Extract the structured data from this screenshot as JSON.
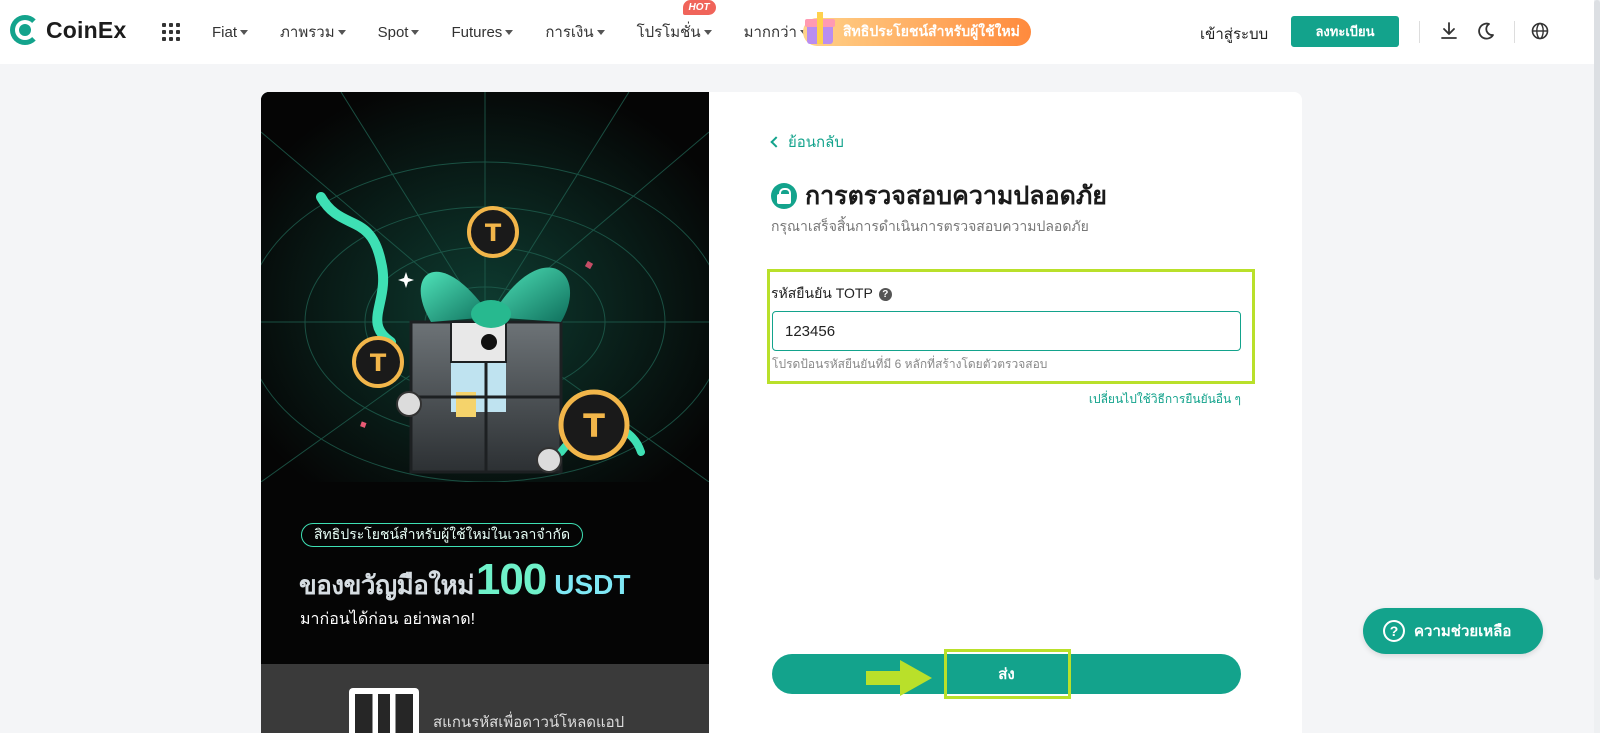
{
  "header": {
    "logo_text": "CoinEx",
    "nav_items": [
      {
        "label": "Fiat",
        "has_caret": true
      },
      {
        "label": "ภาพรวม",
        "has_caret": true
      },
      {
        "label": "Spot",
        "has_caret": true
      },
      {
        "label": "Futures",
        "has_caret": true
      },
      {
        "label": "การเงิน",
        "has_caret": true
      },
      {
        "label": "โปรโมชั่น",
        "has_caret": true,
        "badge": "HOT"
      },
      {
        "label": "มากกว่า",
        "has_caret": true
      }
    ],
    "promo_label": "สิทธิประโยชน์สำหรับผู้ใช้ใหม่",
    "login_label": "เข้าสู่ระบบ",
    "register_label": "ลงทะเบียน",
    "icons": [
      "download-icon",
      "moon-icon",
      "globe-icon"
    ]
  },
  "banner": {
    "pill_text": "สิทธิประโยชน์สำหรับผู้ใช้ใหม่ในเวลาจำกัด",
    "headline_text": "ของขวัญมือใหม่",
    "headline_number": "100",
    "headline_unit": "USDT",
    "subline": "มาก่อนได้ก่อน อย่าพลาด!",
    "footer_text": "สแกนรหัสเพื่อดาวน์โหลดแอป"
  },
  "form": {
    "back_label": "ย้อนกลับ",
    "title": "การตรวจสอบความปลอดภัย",
    "description": "กรุณาเสร็จสิ้นการดำเนินการตรวจสอบความปลอดภัย",
    "field_label": "รหัสยืนยัน TOTP",
    "field_value": "123456",
    "field_hint": "โปรดป้อนรหัสยืนยันที่มี 6 หลักที่สร้างโดยตัวตรวจสอบ",
    "switch_label": "เปลี่ยนไปใช้วิธีการยืนยันอื่น ๆ",
    "submit_label": "ส่ง"
  },
  "help": {
    "label": "ความช่วยเหลือ",
    "icon_glyph": "?"
  },
  "colors": {
    "brand": "#13a38c",
    "annotation": "#b9e02a",
    "hot": "#f0645a"
  }
}
